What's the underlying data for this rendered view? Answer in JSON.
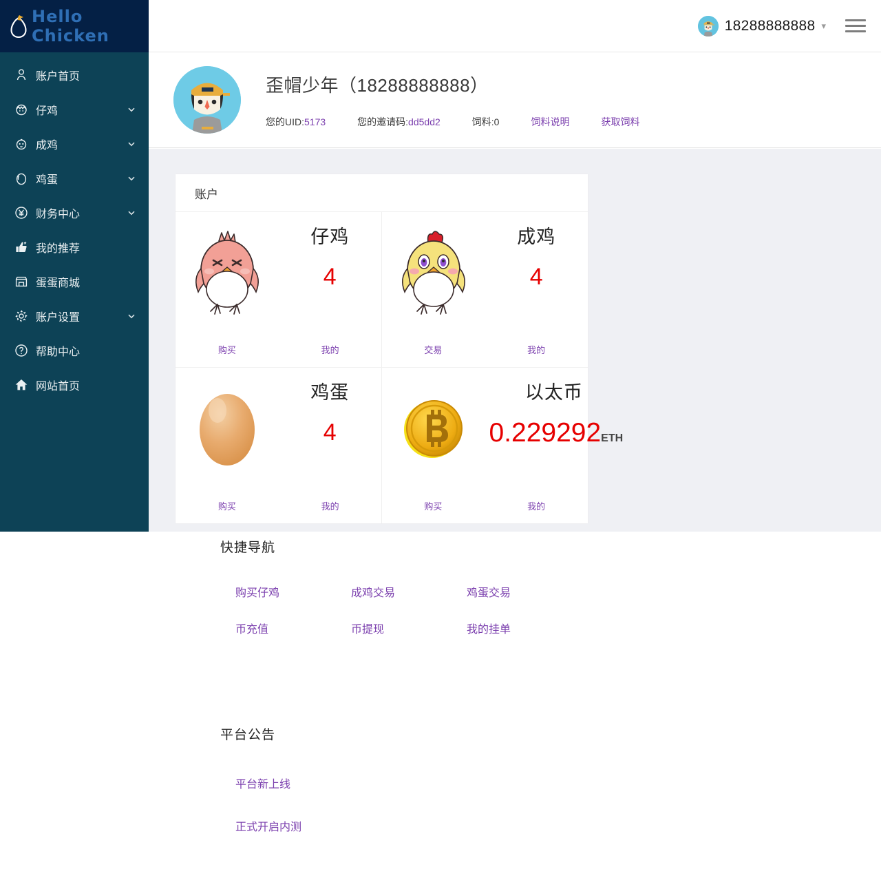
{
  "brand": {
    "name": "Hello  Chicken",
    "logo_icon": "egg-chick-logo",
    "text_color": "#2f6fb5",
    "header_bg": "#042045",
    "sidebar_bg": "#0d4256"
  },
  "topbar": {
    "user_phone": "18288888888",
    "avatar_icon": "user-avatar",
    "chevron_icon": "chevron-down-icon",
    "menu_icon": "hamburger-menu-icon"
  },
  "sidebar": {
    "items": [
      {
        "label": "账户首页",
        "icon": "user-icon",
        "expandable": false
      },
      {
        "label": "仔鸡",
        "icon": "chick-egg-icon",
        "expandable": true
      },
      {
        "label": "成鸡",
        "icon": "chicken-icon",
        "expandable": true
      },
      {
        "label": "鸡蛋",
        "icon": "egg-icon",
        "expandable": true
      },
      {
        "label": "财务中心",
        "icon": "yen-circle-icon",
        "expandable": true
      },
      {
        "label": "我的推荐",
        "icon": "thumbs-up-icon",
        "expandable": false
      },
      {
        "label": "蛋蛋商城",
        "icon": "shop-icon",
        "expandable": false
      },
      {
        "label": "账户设置",
        "icon": "gear-icon",
        "expandable": true
      },
      {
        "label": "帮助中心",
        "icon": "question-circle-icon",
        "expandable": false
      },
      {
        "label": "网站首页",
        "icon": "home-icon",
        "expandable": false
      }
    ]
  },
  "profile": {
    "avatar_icon": "boy-with-cap-avatar",
    "name": "歪帽少年",
    "phone_display": "（18288888888）",
    "uid_label": "您的UID:",
    "uid_value": "5173",
    "invite_label": "您的邀请码:",
    "invite_value": "dd5dd2",
    "feed_label": "饲料:",
    "feed_value": "0",
    "links": [
      "饲料说明",
      "获取饲料"
    ]
  },
  "account_card": {
    "title": "账户",
    "cells": [
      {
        "art": "pink-chick-icon",
        "title": "仔鸡",
        "value": "4",
        "unit": "",
        "links": [
          "购买",
          "我的"
        ]
      },
      {
        "art": "yellow-chicken-icon",
        "title": "成鸡",
        "value": "4",
        "unit": "",
        "links": [
          "交易",
          "我的"
        ]
      },
      {
        "art": "egg-icon",
        "title": "鸡蛋",
        "value": "4",
        "unit": "",
        "links": [
          "购买",
          "我的"
        ]
      },
      {
        "art": "gold-coin-icon",
        "title": "以太币",
        "value": "0.229292",
        "unit": "ETH",
        "links": [
          "购买",
          "我的"
        ]
      }
    ]
  },
  "quick_nav": {
    "title": "快捷导航",
    "links": [
      "购买仔鸡",
      "成鸡交易",
      "鸡蛋交易",
      "币充值",
      "币提现",
      "我的挂单"
    ]
  },
  "announcements": {
    "title": "平台公告",
    "items": [
      "平台新上线",
      "正式开启内测"
    ]
  },
  "colors": {
    "link_purple": "#7b3fae",
    "value_red": "#e60000",
    "content_bg": "#eff0f4"
  }
}
